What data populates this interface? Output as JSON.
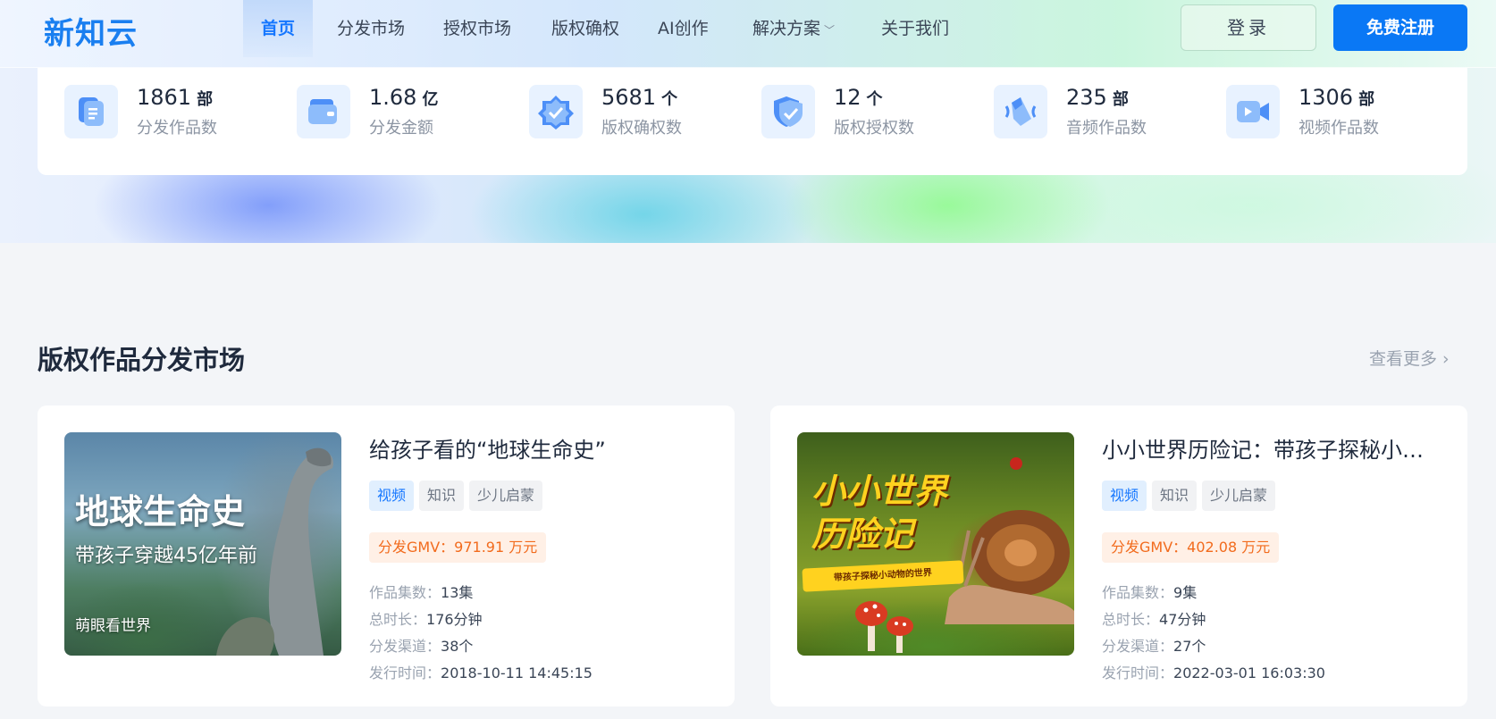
{
  "nav": {
    "logo": "新知云",
    "items": [
      {
        "label": "首页",
        "active": true
      },
      {
        "label": "分发市场"
      },
      {
        "label": "授权市场"
      },
      {
        "label": "版权确权"
      },
      {
        "label": "AI创作"
      },
      {
        "label": "解决方案",
        "dropdown": true
      },
      {
        "label": "关于我们"
      }
    ],
    "login": "登录",
    "register": "免费注册"
  },
  "stats": [
    {
      "value": "1861",
      "unit": "部",
      "label": "分发作品数",
      "icon": "document-icon"
    },
    {
      "value": "1.68",
      "unit": "亿",
      "label": "分发金额",
      "icon": "wallet-icon"
    },
    {
      "value": "5681",
      "unit": "个",
      "label": "版权确权数",
      "icon": "verified-badge-icon"
    },
    {
      "value": "12",
      "unit": "个",
      "label": "版权授权数",
      "icon": "shield-check-icon"
    },
    {
      "value": "235",
      "unit": "部",
      "label": "音频作品数",
      "icon": "speaker-icon"
    },
    {
      "value": "1306",
      "unit": "部",
      "label": "视频作品数",
      "icon": "video-camera-icon"
    }
  ],
  "section": {
    "title": "版权作品分发市场",
    "see_more": "查看更多"
  },
  "labels": {
    "episodes": "作品集数：",
    "duration": "总时长：",
    "channels": "分发渠道：",
    "release": "发行时间："
  },
  "cards": [
    {
      "title": "给孩子看的“地球生命史”",
      "tags": [
        "视频",
        "知识",
        "少儿启蒙"
      ],
      "gmv": "分发GMV：971.91 万元",
      "episodes": "13集",
      "duration": "176分钟",
      "channels": "38个",
      "release": "2018-10-11 14:45:15",
      "thumb": {
        "title": "地球生命史",
        "subtitle": "带孩子穿越45亿年前",
        "brand": "萌眼看世界"
      }
    },
    {
      "title": "小小世界历险记：带孩子探秘小动物的世界",
      "tags": [
        "视频",
        "知识",
        "少儿启蒙"
      ],
      "gmv": "分发GMV：402.08 万元",
      "episodes": "9集",
      "duration": "47分钟",
      "channels": "27个",
      "release": "2022-03-01 16:03:30",
      "thumb": {
        "title_line1": "小小世界",
        "title_line2": "历险记",
        "banner": "带孩子探秘小动物的世界"
      }
    }
  ]
}
